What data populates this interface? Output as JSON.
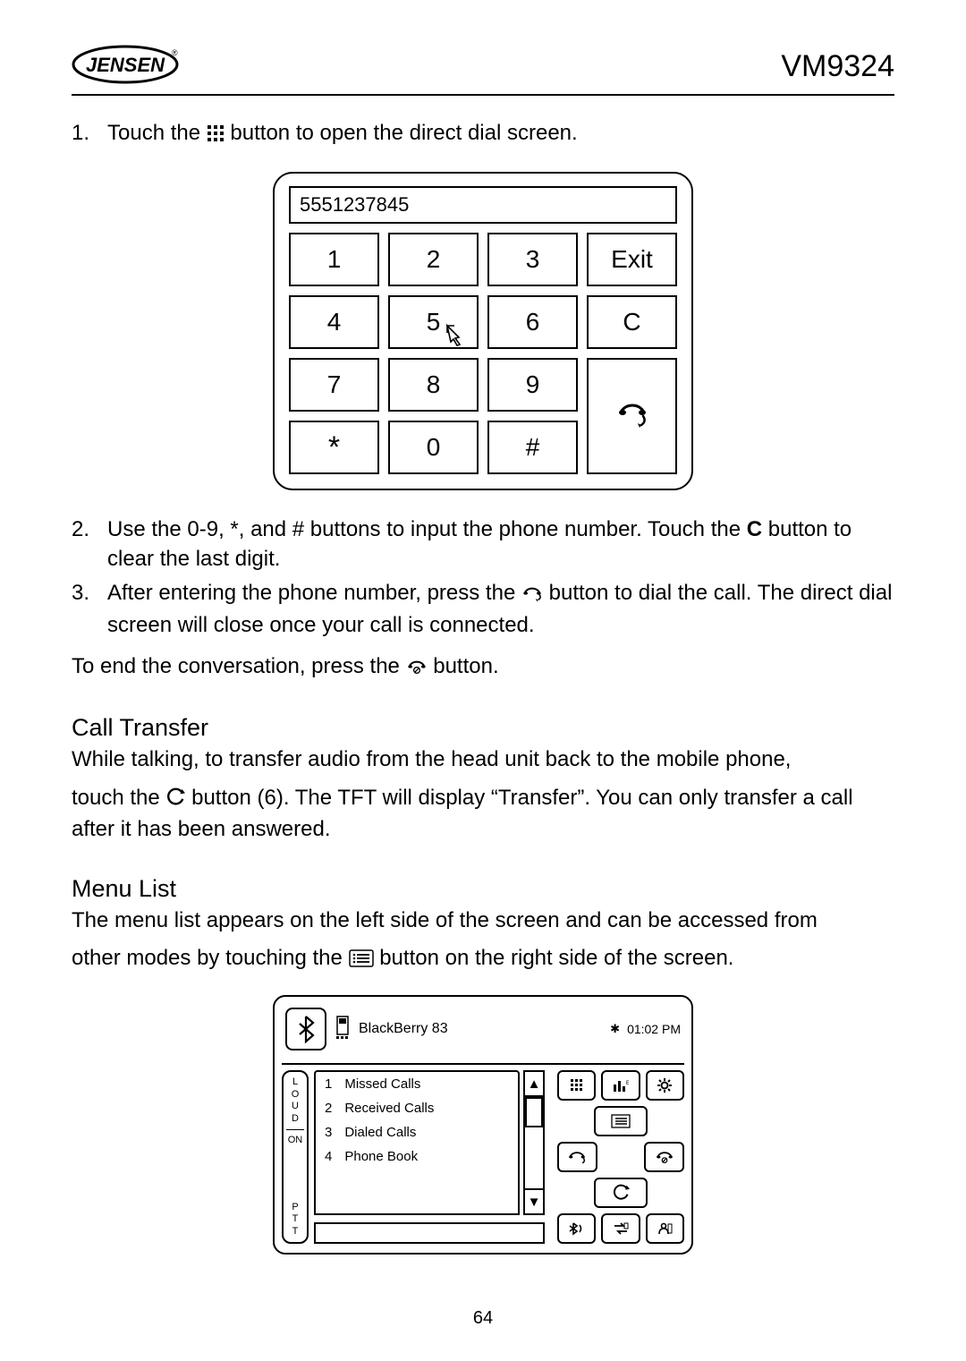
{
  "header": {
    "brand": "JENSEN",
    "model": "VM9324"
  },
  "steps": {
    "s1_a": "Touch the ",
    "s1_b": " button to open the direct dial screen.",
    "s2": "Use the 0-9, *, and # buttons to input the phone number. Touch the ",
    "s2_bold": "C",
    "s2_b": " button to clear the last digit.",
    "s3_a": "After entering the phone number, press the ",
    "s3_b": " button to dial the call. The direct dial screen will close once your call is connected."
  },
  "end_call_a": "To end the conversation, press the ",
  "end_call_b": " button.",
  "call_transfer": {
    "heading": "Call Transfer",
    "line1": "While talking, to transfer audio from the head unit back to the mobile phone,",
    "line2a": "touch the ",
    "line2b": " button (6). The TFT will display “Transfer”. You can only transfer a call after it has been answered."
  },
  "menu_list": {
    "heading": "Menu List",
    "line1": "The menu list appears on the left side of the screen and can be accessed from",
    "line2a": "other modes by touching the ",
    "line2b": " button on the right side of the screen."
  },
  "dialpad": {
    "display": "5551237845",
    "keys": [
      "1",
      "2",
      "3",
      "Exit",
      "4",
      "5",
      "6",
      "C",
      "7",
      "8",
      "9",
      "*",
      "0",
      "#"
    ]
  },
  "menu_fig": {
    "device": "BlackBerry 83",
    "time": "01:02 PM",
    "loud": "LOUD",
    "on": "ON",
    "ptt": "PTT",
    "items": [
      {
        "n": "1",
        "label": "Missed Calls"
      },
      {
        "n": "2",
        "label": "Received Calls"
      },
      {
        "n": "3",
        "label": "Dialed Calls"
      },
      {
        "n": "4",
        "label": "Phone Book"
      }
    ]
  },
  "page_number": "64"
}
